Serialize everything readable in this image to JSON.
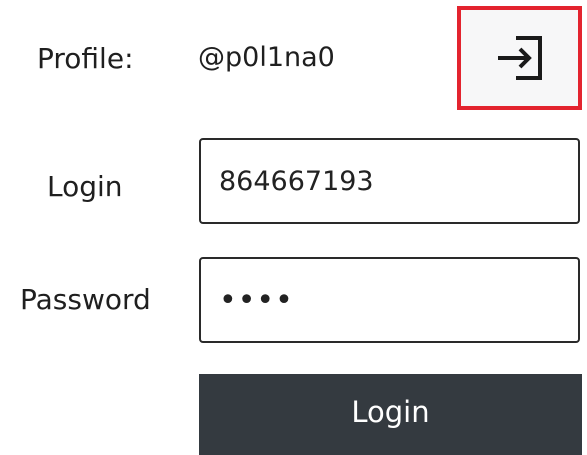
{
  "profile": {
    "label": "Profile:",
    "username": "@p0l1na0",
    "logout_icon": "sign-in-icon"
  },
  "login": {
    "label": "Login",
    "value": "864667193"
  },
  "password": {
    "label": "Password",
    "value": "1234"
  },
  "submit": {
    "label": "Login"
  },
  "colors": {
    "highlight": "#e3232e",
    "button_bg": "#343a40"
  }
}
